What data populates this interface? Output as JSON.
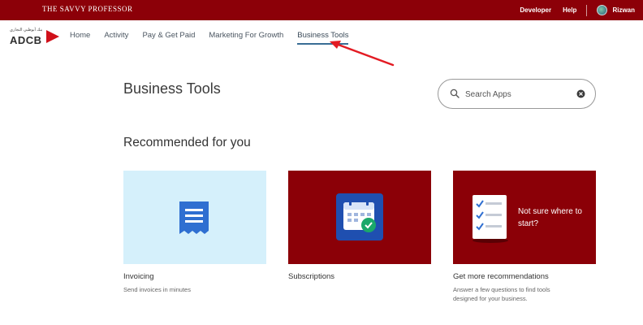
{
  "topbar": {
    "brand": "THE SAVVY PROFESSOR",
    "links": [
      "Developer",
      "Help"
    ],
    "username": "Rizwan"
  },
  "logo": {
    "arabic": "بنك أبوظبي التجاري",
    "text": "ADCB"
  },
  "nav": {
    "items": [
      "Home",
      "Activity",
      "Pay & Get Paid",
      "Marketing For Growth",
      "Business Tools"
    ],
    "active_index": 4
  },
  "page": {
    "title": "Business Tools"
  },
  "search": {
    "placeholder": "Search Apps"
  },
  "recommended": {
    "title": "Recommended for you",
    "cards": [
      {
        "title": "Invoicing",
        "desc": "Send invoices in minutes",
        "icon": "receipt-icon"
      },
      {
        "title": "Subscriptions",
        "desc": "",
        "icon": "calendar-icon"
      },
      {
        "title": "Get more recommendations",
        "desc": "Answer a few questions to find tools designed for your business.",
        "icon": "checklist-icon",
        "overlay": "Not sure where to start?"
      }
    ]
  },
  "colors": {
    "brand_red": "#8c0008",
    "card_light_blue": "#d5f0fb",
    "active_underline": "#3a6d95",
    "annotation_arrow": "#e31b23"
  }
}
